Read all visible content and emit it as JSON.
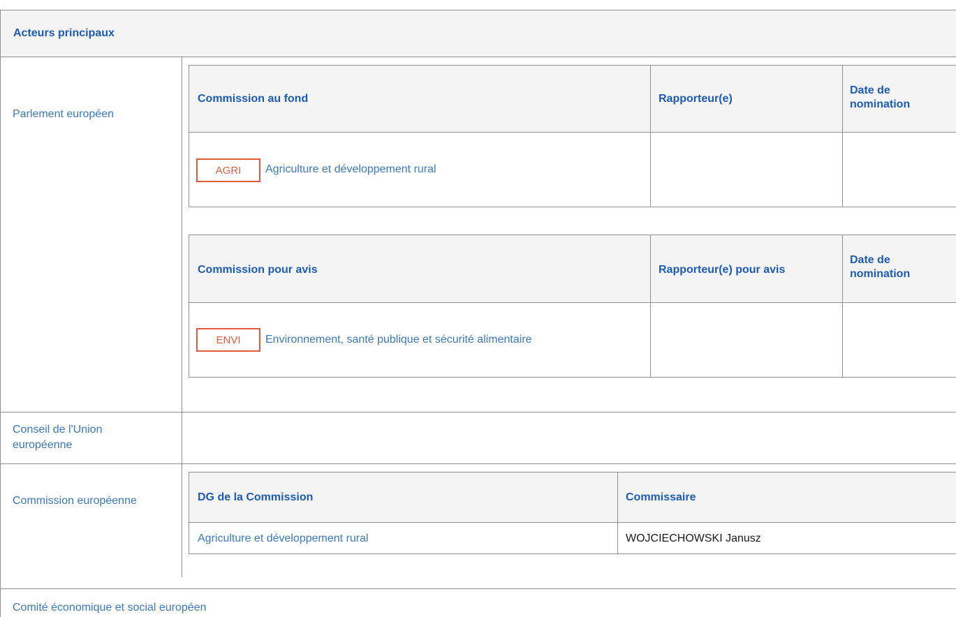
{
  "header": {
    "title": "Acteurs principaux"
  },
  "actors": {
    "parlement": {
      "label": "Parlement européen",
      "lead_committee": {
        "headers": [
          "Commission au fond",
          "Rapporteur(e)",
          "Date de nomination"
        ],
        "rows": [
          {
            "code": "AGRI",
            "name": "Agriculture et développement rural",
            "rapporteur": "",
            "date": ""
          }
        ]
      },
      "opinion_committee": {
        "headers": [
          "Commission pour avis",
          "Rapporteur(e) pour avis",
          "Date de nomination"
        ],
        "rows": [
          {
            "code": "ENVI",
            "name": "Environnement, santé publique et sécurité alimentaire",
            "rapporteur": "",
            "date": ""
          }
        ]
      }
    },
    "conseil": {
      "label": "Conseil de l'Union européenne"
    },
    "commission": {
      "label": "Commission européenne",
      "table": {
        "headers": [
          "DG de la Commission",
          "Commissaire"
        ],
        "rows": [
          {
            "dg": "Agriculture et développement rural",
            "commissioner": "WOJCIECHOWSKI Janusz"
          }
        ]
      }
    },
    "cese": {
      "label": "Comité économique et social européen"
    }
  },
  "colors": {
    "heading_blue": "#1c5bb4",
    "link_blue": "#3a78c0",
    "badge_red": "#e15a3b",
    "header_bg": "#f4f4f4",
    "border": "#8f8f8f"
  }
}
